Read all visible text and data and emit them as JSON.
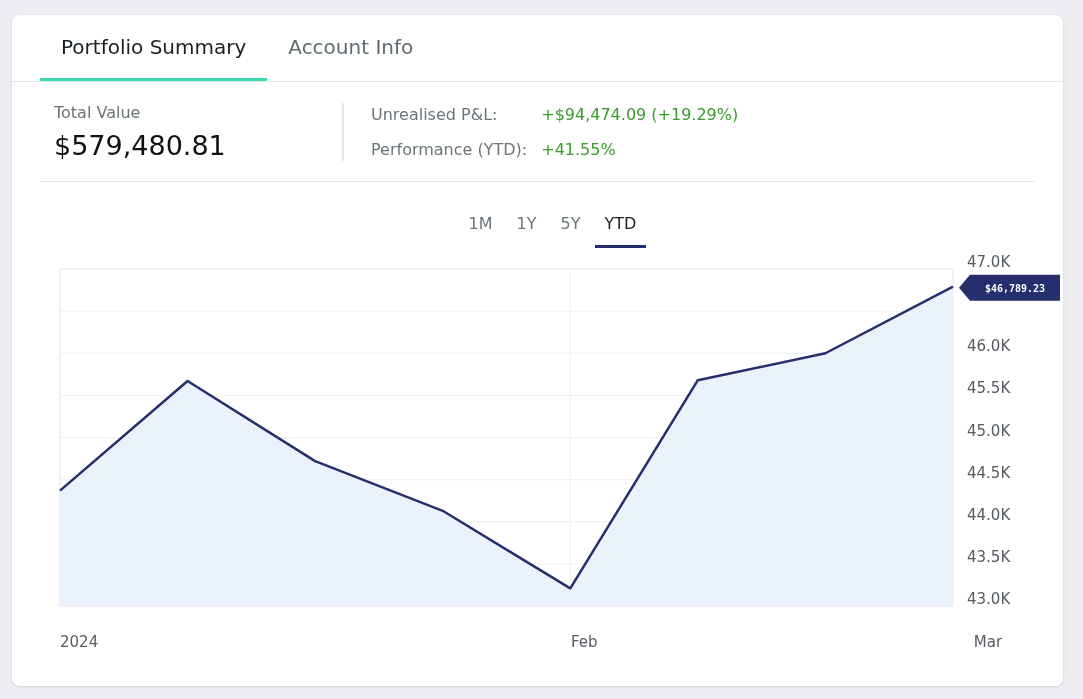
{
  "tabs": [
    {
      "label": "Portfolio Summary",
      "selected": true
    },
    {
      "label": "Account Info",
      "selected": false
    }
  ],
  "total_value": {
    "label": "Total Value",
    "value": "$579,480.81"
  },
  "metrics": [
    {
      "label": "Unrealised P&L:",
      "value": "+$94,474.09 (+19.29%)"
    },
    {
      "label": "Performance (YTD):",
      "value": "+41.55%"
    }
  ],
  "periods": [
    {
      "label": "1M",
      "selected": false
    },
    {
      "label": "1Y",
      "selected": false
    },
    {
      "label": "5Y",
      "selected": false
    },
    {
      "label": "YTD",
      "selected": true
    }
  ],
  "chart": {
    "current_price": "$46,789.23",
    "chart_data": {
      "type": "area",
      "categories": [
        "2024",
        null,
        null,
        null,
        "Feb",
        null,
        null,
        "Mar"
      ],
      "series": [
        {
          "color": "#262f6e",
          "values": [
            44.37,
            45.67,
            44.72,
            44.13,
            43.21,
            45.68,
            46.0,
            46.79
          ]
        }
      ],
      "ylim": [
        43,
        47
      ],
      "grid": true,
      "yticks": [
        {
          "value": 43,
          "label": "43.0K"
        },
        {
          "value": 43.5,
          "label": "43.5K"
        },
        {
          "value": 44,
          "label": "44.0K"
        },
        {
          "value": 44.5,
          "label": "44.5K"
        },
        {
          "value": 45,
          "label": "45.0K"
        },
        {
          "value": 45.5,
          "label": "45.5K"
        },
        {
          "value": 46,
          "label": "46.0K"
        },
        {
          "value": 47,
          "label": "47.0K"
        }
      ]
    }
  }
}
